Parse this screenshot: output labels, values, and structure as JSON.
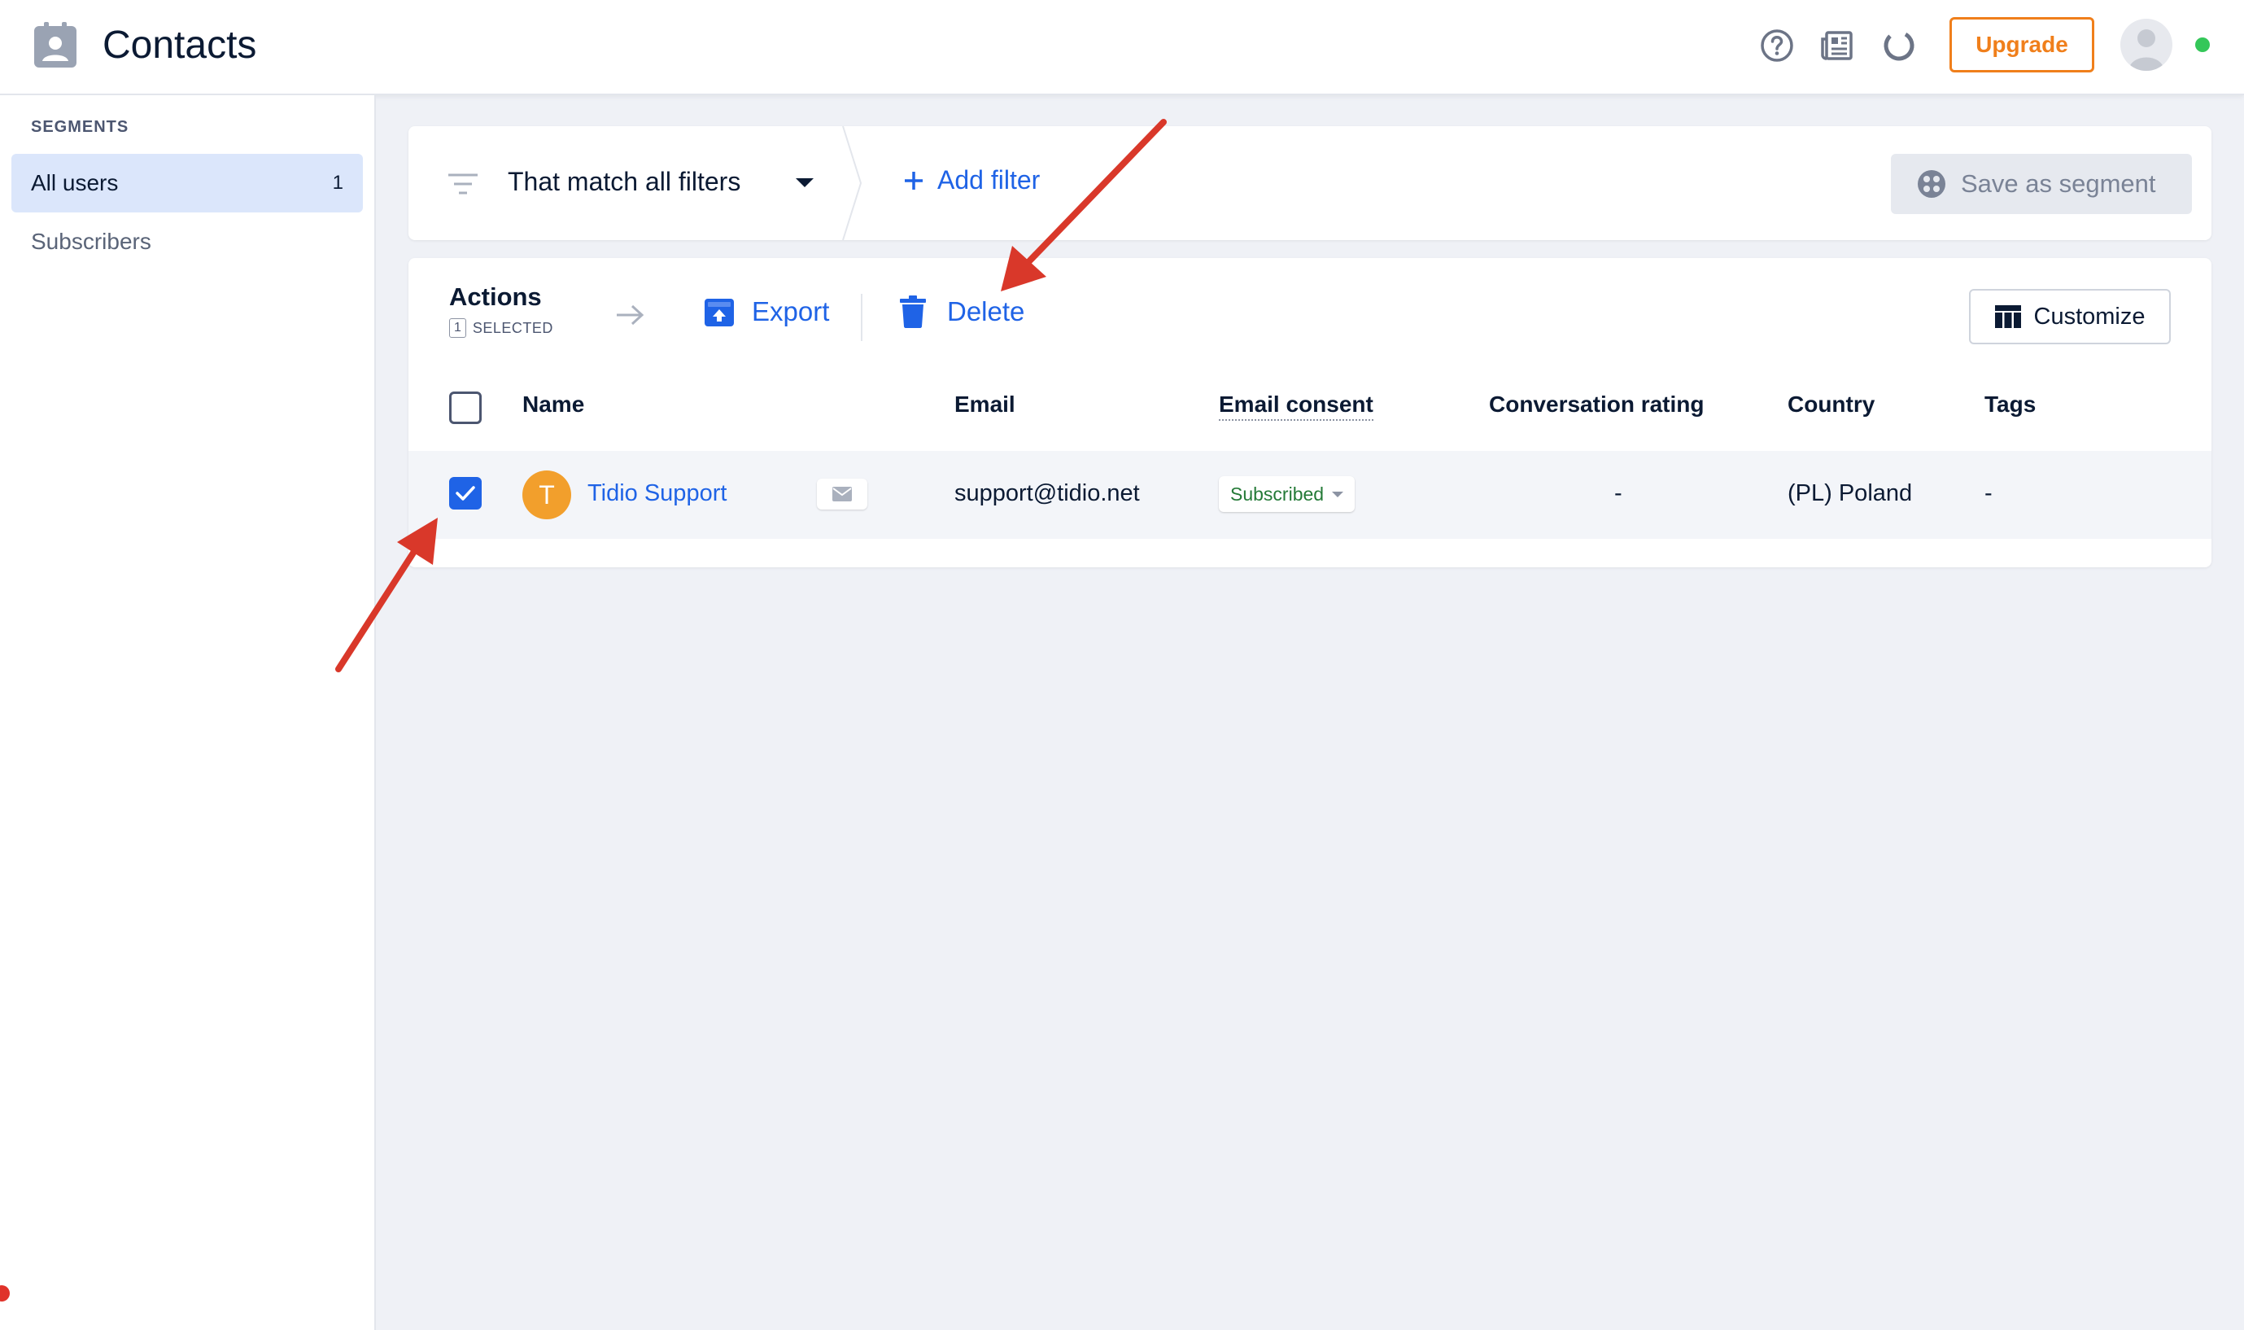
{
  "header": {
    "title": "Contacts",
    "upgrade_label": "Upgrade",
    "icons": [
      "help-icon",
      "newspaper-icon",
      "loading-ring-icon"
    ]
  },
  "sidebar": {
    "heading": "SEGMENTS",
    "items": [
      {
        "label": "All users",
        "count": "1",
        "active": true
      },
      {
        "label": "Subscribers",
        "count": "",
        "active": false
      }
    ]
  },
  "filters": {
    "match_label": "That match all filters",
    "add_filter_label": "Add filter",
    "save_segment_label": "Save as segment"
  },
  "actions": {
    "title": "Actions",
    "selected_count": "1",
    "selected_label": "SELECTED",
    "export_label": "Export",
    "delete_label": "Delete",
    "customize_label": "Customize"
  },
  "table": {
    "columns": [
      "Name",
      "Email",
      "Email consent",
      "Conversation rating",
      "Country",
      "Tags"
    ],
    "rows": [
      {
        "initial": "T",
        "name": "Tidio Support",
        "email": "support@tidio.net",
        "consent": "Subscribed",
        "rating": "-",
        "country": "(PL) Poland",
        "tags": "-",
        "checked": true
      }
    ]
  },
  "colors": {
    "accent": "#1f63e6",
    "upgrade": "#f07f1b",
    "avatar": "#f29f2c",
    "annotation_arrow": "#d9382a",
    "online": "#34c759"
  }
}
